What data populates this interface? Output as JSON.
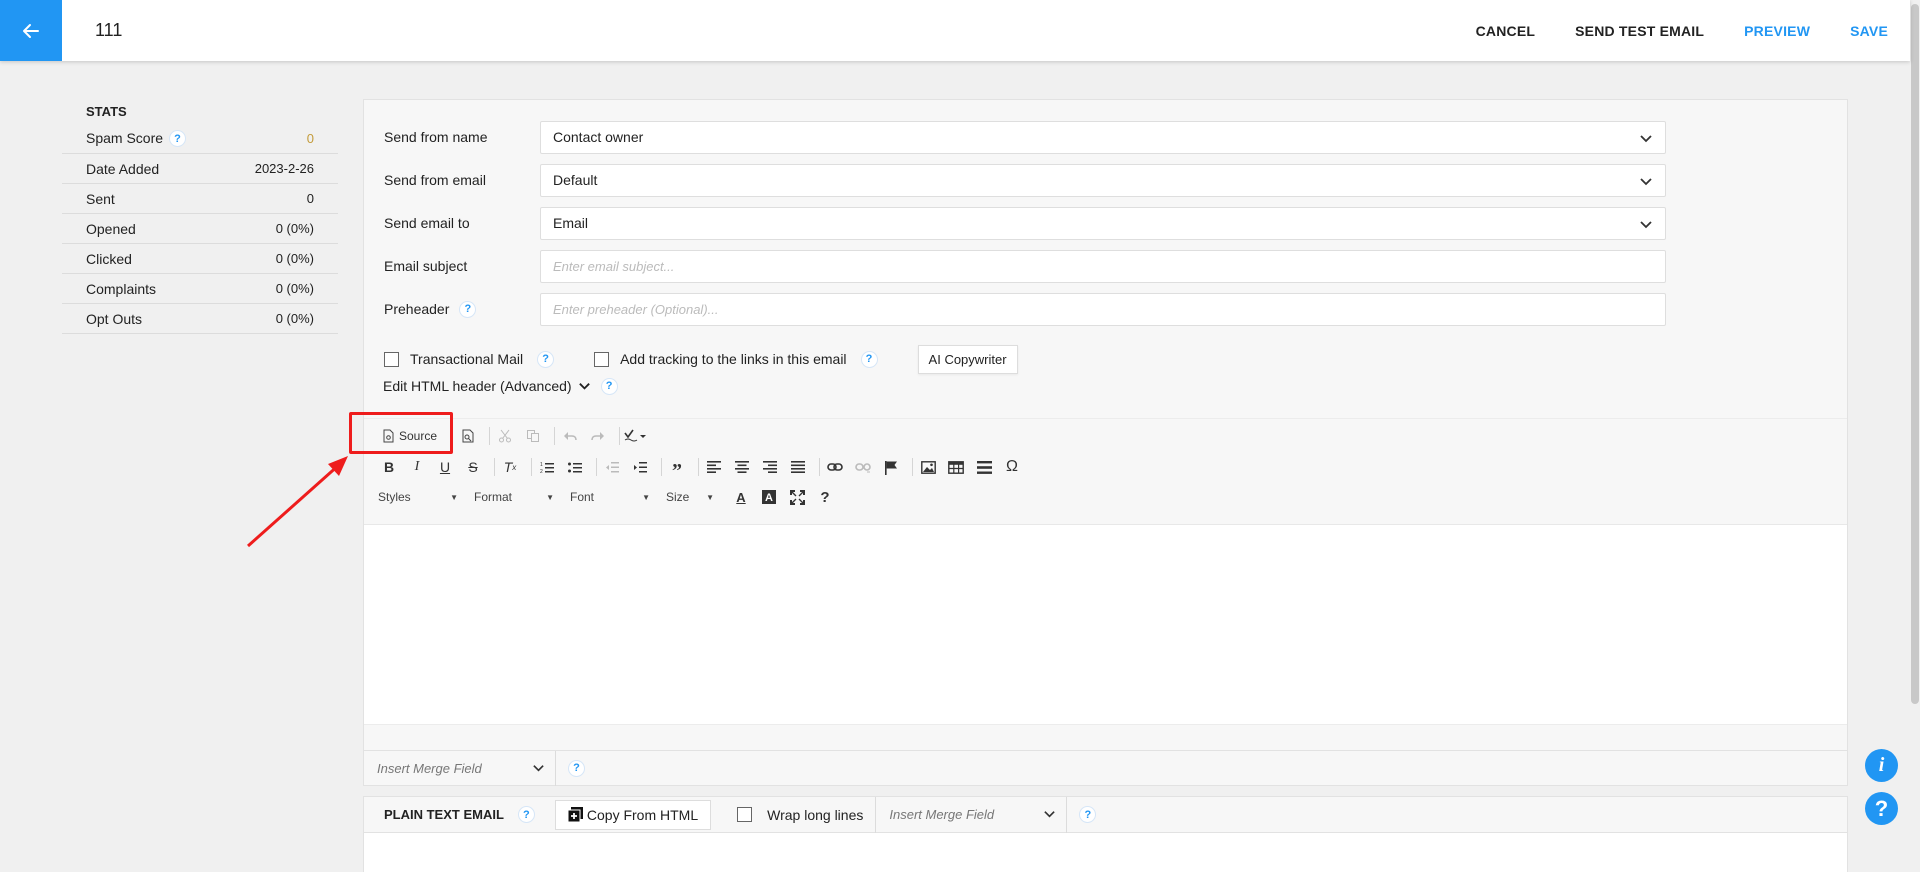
{
  "header": {
    "title": "111",
    "actions": {
      "cancel": "CANCEL",
      "send_test": "SEND TEST EMAIL",
      "preview": "PREVIEW",
      "save": "SAVE"
    }
  },
  "stats": {
    "title": "STATS",
    "rows": [
      {
        "label": "Spam Score",
        "value": "0"
      },
      {
        "label": "Date Added",
        "value": "2023-2-26"
      },
      {
        "label": "Sent",
        "value": "0"
      },
      {
        "label": "Opened",
        "value": "0 (0%)"
      },
      {
        "label": "Clicked",
        "value": "0 (0%)"
      },
      {
        "label": "Complaints",
        "value": "0 (0%)"
      },
      {
        "label": "Opt Outs",
        "value": "0 (0%)"
      }
    ]
  },
  "form": {
    "send_from_name": {
      "label": "Send from name",
      "value": "Contact owner"
    },
    "send_from_email": {
      "label": "Send from email",
      "value": "Default"
    },
    "send_email_to": {
      "label": "Send email to",
      "value": "Email"
    },
    "email_subject": {
      "label": "Email subject",
      "placeholder": "Enter email subject..."
    },
    "preheader": {
      "label": "Preheader",
      "placeholder": "Enter preheader (Optional)..."
    },
    "transactional_mail": "Transactional Mail",
    "add_tracking": "Add tracking to the links in this email",
    "ai_copywriter": "AI Copywriter",
    "edit_html_header": "Edit HTML header (Advanced)"
  },
  "editor": {
    "source_label": "Source",
    "combos": {
      "styles": "Styles",
      "format": "Format",
      "font": "Font",
      "size": "Size"
    },
    "insert_merge_field": "Insert Merge Field"
  },
  "plain_text": {
    "title": "PLAIN TEXT EMAIL",
    "copy_from_html": "Copy From HTML",
    "wrap_long_lines": "Wrap long lines",
    "insert_merge_field": "Insert Merge Field"
  },
  "help": {
    "question": "?",
    "info": "i"
  },
  "colors": {
    "accent": "#2196f3",
    "annotation": "#ee1c1c",
    "spam_value": "#c39b3a"
  },
  "icons": {
    "back": "arrow-left-icon",
    "help": "question-circle-icon",
    "chevron": "chevron-down-icon"
  }
}
